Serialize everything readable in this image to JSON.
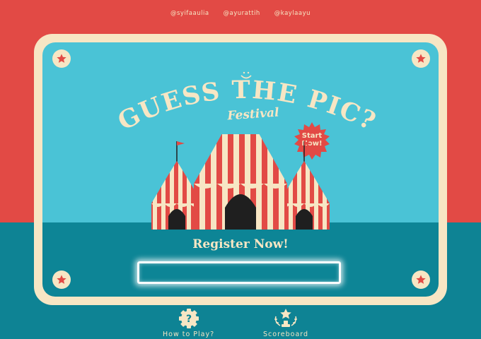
{
  "credits": [
    "@syifaaulia",
    "@ayurattih",
    "@kaylaayu"
  ],
  "title": "GUESS THE PIC?",
  "subtitle": "Festival",
  "start_button": {
    "line1": "Start",
    "line2": "Now!"
  },
  "register": {
    "label": "Register Now!",
    "input_value": ""
  },
  "bottom_nav": {
    "how_to_play": "How to Play?",
    "scoreboard": "Scoreboard"
  },
  "colors": {
    "red": "#e24a45",
    "sky": "#4ac3d6",
    "teal": "#0d8596",
    "cream": "#f7e6c4",
    "dark": "#1f1f1f"
  },
  "icons": [
    "star-icon",
    "smile-icon",
    "circus-tent-icon",
    "flag-icon",
    "gear-question-icon",
    "trophy-icon"
  ]
}
